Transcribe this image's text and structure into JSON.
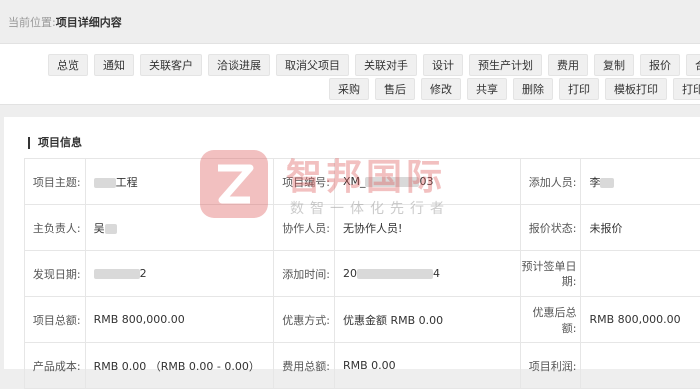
{
  "breadcrumb": {
    "prefix": "当前位置:",
    "current": "项目详细内容"
  },
  "toolbar": {
    "row1": [
      "总览",
      "通知",
      "关联客户",
      "洽谈进展",
      "取消父项目",
      "关联对手",
      "设计",
      "预生产计划",
      "费用",
      "复制",
      "报价",
      "合同"
    ],
    "row2": [
      "采购",
      "售后",
      "修改",
      "共享",
      "删除",
      "打印",
      "模板打印",
      "打印"
    ]
  },
  "section": {
    "title": "项目信息"
  },
  "fields": {
    "r1": {
      "l1": "项目主题:",
      "v1": "工程",
      "l2": "项目编号:",
      "v2a": "XM_",
      "v2b": "03",
      "l3": "添加人员:",
      "v3": "李"
    },
    "r2": {
      "l1": "主负责人:",
      "v1": "吴",
      "l2": "协作人员:",
      "v2": "无协作人员!",
      "l3": "报价状态:",
      "v3": "未报价"
    },
    "r3": {
      "l1": "发现日期:",
      "v1": "2",
      "l2": "添加时间:",
      "v2a": "20",
      "v2b": "4",
      "l3": "预计签单日期:",
      "v3": ""
    },
    "r4": {
      "l1": "项目总额:",
      "v1": "RMB 800,000.00",
      "l2": "优惠方式:",
      "v2": "优惠金额 RMB 0.00",
      "l3": "优惠后总额:",
      "v3": "RMB 800,000.00"
    },
    "r5": {
      "l1": "产品成本:",
      "v1": "RMB 0.00 （RMB 0.00 - 0.00）",
      "l2": "费用总额:",
      "v2": "RMB 0.00",
      "l3": "项目利润:",
      "v3": ""
    }
  },
  "watermark": {
    "title": "智邦国际",
    "subtitle": "数智一体化先行者"
  },
  "colors": {
    "watermark_red": "#de5a5a"
  }
}
